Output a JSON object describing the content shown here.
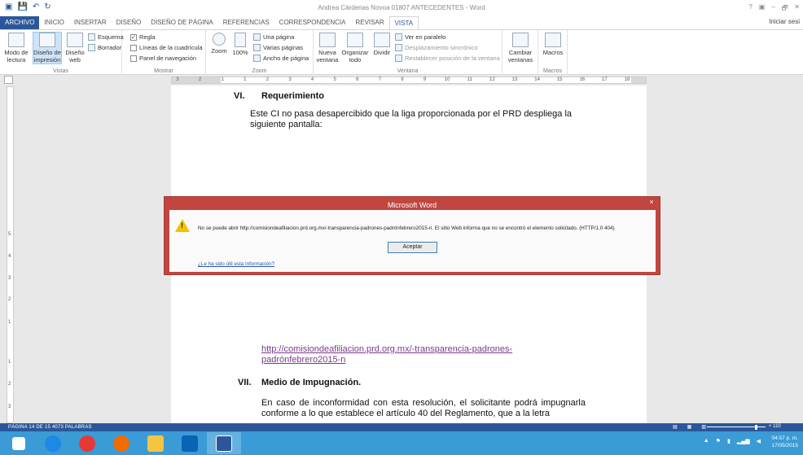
{
  "window": {
    "title": "Andrea Cárdenas Novoa 01807 ANTECEDENTES - Word",
    "controls": [
      "?",
      "▣",
      "–",
      "🗗",
      "✕"
    ]
  },
  "tabs": [
    "ARCHIVO",
    "INICIO",
    "INSERTAR",
    "DISEÑO",
    "DISEÑO DE PÁGINA",
    "REFERENCIAS",
    "CORRESPONDENCIA",
    "REVISAR",
    "VISTA"
  ],
  "signin": "Iniciar sesi",
  "ribbon": {
    "vistas": {
      "label": "Vistas",
      "modo_lectura": "Modo de lectura",
      "diseno_impresion": "Diseño de impresión",
      "diseno_web": "Diseño web",
      "esquema": "Esquema",
      "borrador": "Borrador"
    },
    "mostrar": {
      "label": "Mostrar",
      "regla": "Regla",
      "lineas": "Líneas de la cuadrícula",
      "panel": "Panel de navegación"
    },
    "zoom": {
      "label": "Zoom",
      "zoom": "Zoom",
      "pct": "100%",
      "una_pagina": "Una página",
      "varias_paginas": "Varias páginas",
      "ancho_pagina": "Ancho de página"
    },
    "ventana": {
      "label": "Ventana",
      "nueva": "Nueva ventana",
      "organizar": "Organizar todo",
      "dividir": "Dividir",
      "paralelo": "Ver en paralelo",
      "sincronico": "Desplazamiento sincrónico",
      "restablecer": "Restablecer posición de la ventana",
      "cambiar": "Cambiar ventanas"
    },
    "macros": {
      "label": "Macros",
      "macros": "Macros"
    }
  },
  "ruler_numbers": [
    "3",
    "2",
    "1",
    "1",
    "2",
    "3",
    "4",
    "5",
    "6",
    "7",
    "8",
    "9",
    "10",
    "11",
    "12",
    "13",
    "14",
    "15",
    "16",
    "17",
    "18"
  ],
  "vruler_numbers": [
    "5",
    "4",
    "3",
    "2",
    "1",
    "1",
    "2",
    "3"
  ],
  "document": {
    "sec6_num": "VI.",
    "sec6_title": "Requerimiento",
    "para1": "Este CI no pasa desapercibido que la liga proporcionada por el PRD despliega la siguiente pantalla:",
    "link": "http://comisiondeafiliacion.prd.org.mx/-transparencia-padrones-padrónfebrero2015-n",
    "sec7_num": "VII.",
    "sec7_title": "Medio de Impugnación.",
    "para2": "En caso de inconformidad con esta resolución, el solicitante podrá impugnarla conforme a lo que establece el artículo 40 del Reglamento, que a la letra"
  },
  "dialog": {
    "title": "Microsoft Word",
    "close": "×",
    "message": "No se puede abrir http://comisiondeafiliacion.prd.org.mx/-transparencia-padrones-padrónfebrero2015-n. El sitio Web informa que no se encontró el elemento solicitado. (HTTP/1.0 404)",
    "ok": "Aceptar",
    "help_link": "¿Le ha sido útil esta información?"
  },
  "status": {
    "text": "PÁGINA 14 DE 15   4073 PALABRAS",
    "zoom": "110"
  },
  "tray": {
    "time": "04:57 p. m.",
    "date": "17/05/2015"
  },
  "colors": {
    "word_blue": "#2b579a",
    "dialog_red": "#c0463f",
    "taskbar": "#3a9bd6"
  }
}
